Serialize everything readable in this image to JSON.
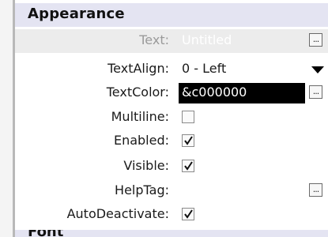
{
  "section": {
    "title": "Appearance"
  },
  "properties": {
    "text": {
      "label": "Text:",
      "value": "Untitled"
    },
    "text_align": {
      "label": "TextAlign:",
      "value": "0 - Left"
    },
    "text_color": {
      "label": "TextColor:",
      "value": "&c000000"
    },
    "multiline": {
      "label": "Multiline:",
      "checked": false
    },
    "enabled": {
      "label": "Enabled:",
      "checked": true
    },
    "visible": {
      "label": "Visible:",
      "checked": true
    },
    "help_tag": {
      "label": "HelpTag:",
      "value": ""
    },
    "auto_deactivate": {
      "label": "AutoDeactivate:",
      "checked": true
    }
  },
  "buttons": {
    "ellipsis": "..."
  },
  "next_section": {
    "title": "Font"
  },
  "icons": {
    "dropdown": "dropdown-arrow-icon",
    "check": "checkmark-icon"
  }
}
